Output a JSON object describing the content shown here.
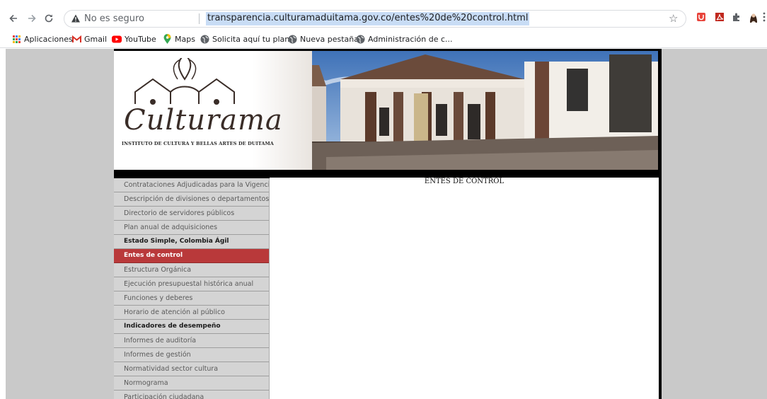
{
  "browser": {
    "back_icon": "arrow-left-icon",
    "forward_icon": "arrow-right-icon",
    "reload_icon": "reload-icon",
    "security_icon": "warning-triangle-icon",
    "security_label": "No es seguro",
    "url": "transparencia.culturamaduitama.gov.co/entes%20de%20control.html",
    "bookmark_star_icon": "star-outline-icon",
    "extensions": [
      "shield-extension-icon",
      "pdf-extension-icon",
      "puzzle-extensions-icon",
      "profile-avatar-icon",
      "kebab-menu-icon"
    ]
  },
  "bookmarks": [
    {
      "icon": "apps-grid-icon",
      "label": "Aplicaciones"
    },
    {
      "icon": "gmail-icon",
      "label": "Gmail"
    },
    {
      "icon": "youtube-icon",
      "label": "YouTube"
    },
    {
      "icon": "maps-pin-icon",
      "label": "Maps"
    },
    {
      "icon": "globe-icon",
      "label": "Solicita aquí tu plan..."
    },
    {
      "icon": "globe-icon",
      "label": "Nueva pestaña"
    },
    {
      "icon": "globe-icon",
      "label": "Administración de c..."
    }
  ],
  "site": {
    "logo_text": "Culturama",
    "tagline": "INSTITUTO DE CULTURA Y BELLAS ARTES DE DUITAMA"
  },
  "menu": [
    {
      "label": "Contrataciones Adjudicadas para la Vigencia",
      "style": "normal"
    },
    {
      "label": "Descripción de divisiones o departamentos",
      "style": "normal"
    },
    {
      "label": "Directorio de servidores públicos",
      "style": "normal"
    },
    {
      "label": "Plan anual de adquisiciones",
      "style": "normal"
    },
    {
      "label": "Estado Simple, Colombia Ágil",
      "style": "bold"
    },
    {
      "label": "Entes de control",
      "style": "active"
    },
    {
      "label": "Estructura Orgánica",
      "style": "normal"
    },
    {
      "label": "Ejecución presupuestal histórica anual",
      "style": "normal"
    },
    {
      "label": "Funciones y deberes",
      "style": "normal"
    },
    {
      "label": "Horario de atención al público",
      "style": "normal"
    },
    {
      "label": "Indicadores de desempeño",
      "style": "bold"
    },
    {
      "label": "Informes de auditoría",
      "style": "normal"
    },
    {
      "label": "Informes de gestión",
      "style": "normal"
    },
    {
      "label": "Normatividad sector cultura",
      "style": "normal"
    },
    {
      "label": "Normograma",
      "style": "normal"
    },
    {
      "label": "Participación ciudadana",
      "style": "normal"
    }
  ],
  "content": {
    "title": "ENTES DE CONTROL"
  },
  "colors": {
    "active_menu": "#b9393a",
    "page_background": "#c9c9c9",
    "url_highlight": "#c8dcf5"
  }
}
